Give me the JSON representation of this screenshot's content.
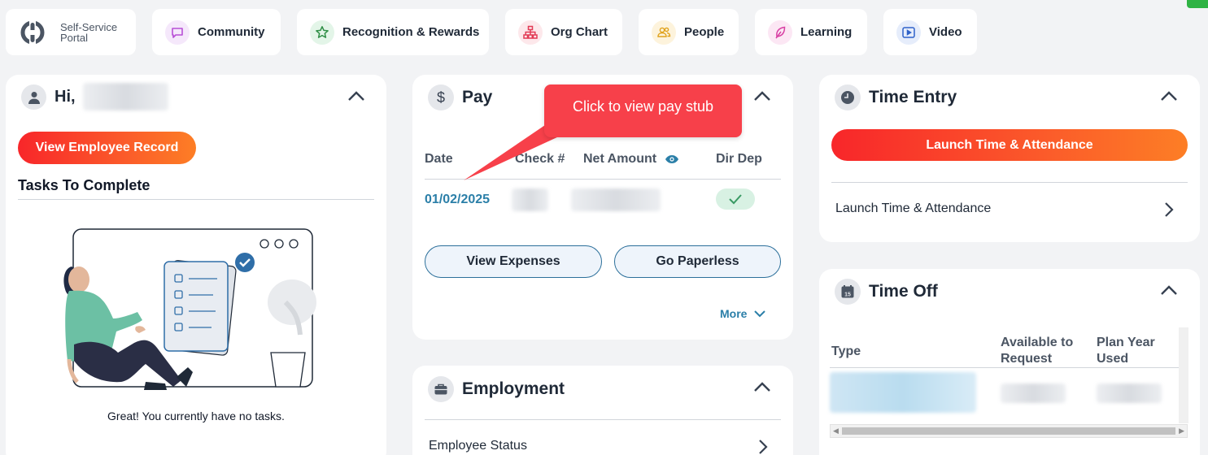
{
  "nav": {
    "logo_text_line1": "Self-Service",
    "logo_text_line2": "Portal",
    "items": [
      {
        "label": "Community",
        "icon": "chat-icon",
        "color": "#b84fd6",
        "bg": "#f5e8fb"
      },
      {
        "label": "Recognition & Rewards",
        "icon": "star-icon",
        "color": "#2f8f46",
        "bg": "#e3f5e8"
      },
      {
        "label": "Org Chart",
        "icon": "org-chart-icon",
        "color": "#e23b55",
        "bg": "#fde8eb"
      },
      {
        "label": "People",
        "icon": "people-icon",
        "color": "#e0a21c",
        "bg": "#fdf3dc"
      },
      {
        "label": "Learning",
        "icon": "leaf-icon",
        "color": "#d83fa3",
        "bg": "#fce7f4"
      },
      {
        "label": "Video",
        "icon": "video-icon",
        "color": "#2f62c9",
        "bg": "#e6edfb"
      }
    ]
  },
  "welcome": {
    "greeting": "Hi,",
    "view_record_label": "View Employee Record",
    "tasks_title": "Tasks To Complete",
    "empty_message": "Great! You currently have no tasks."
  },
  "pay": {
    "title": "Pay",
    "icon": "dollar-icon",
    "columns": [
      "Date",
      "Check #",
      "Net Amount",
      "Dir Dep"
    ],
    "rows": [
      {
        "date": "01/02/2025"
      }
    ],
    "view_expenses_label": "View Expenses",
    "go_paperless_label": "Go Paperless",
    "more_label": "More",
    "tooltip": "Click to view pay stub"
  },
  "employment": {
    "title": "Employment",
    "icon": "briefcase-icon",
    "rows": [
      {
        "label": "Employee Status"
      }
    ]
  },
  "time_entry": {
    "title": "Time Entry",
    "icon": "clock-icon",
    "launch_button_label": "Launch Time & Attendance",
    "link_label": "Launch Time & Attendance"
  },
  "time_off": {
    "title": "Time Off",
    "icon": "calendar-icon",
    "icon_text": "15",
    "col_type": "Type",
    "col_available_1": "Available to",
    "col_available_2": "Request",
    "col_used_1": "Plan Year",
    "col_used_2": "Used"
  },
  "colors": {
    "accent_blue": "#2b7fa8",
    "primary_gradient_start": "#f8262a",
    "primary_gradient_end": "#fd7e25",
    "tooltip_red": "#f7404a"
  }
}
